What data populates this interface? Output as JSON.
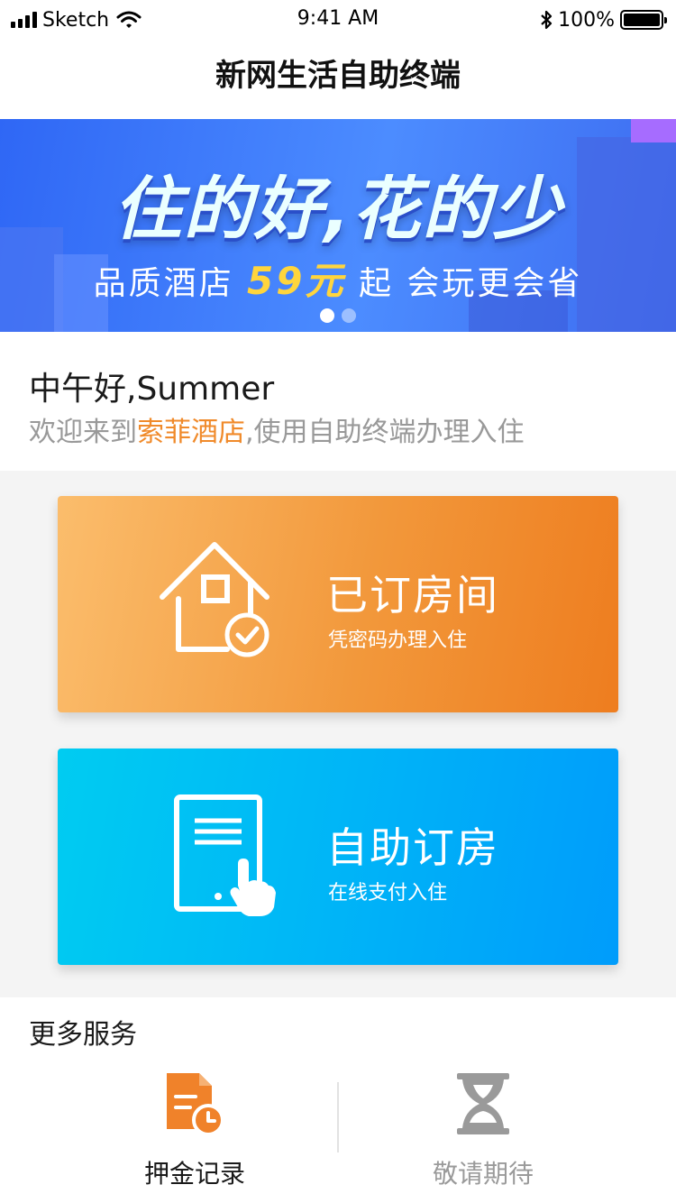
{
  "status_bar": {
    "carrier": "Sketch",
    "time": "9:41 AM",
    "battery_percent": "100%",
    "icons": [
      "signal-icon",
      "wifi-icon",
      "bluetooth-icon",
      "battery-icon"
    ]
  },
  "nav": {
    "title": "新网生活自助终端"
  },
  "banner": {
    "headline": "住的好,花的少",
    "subline_before": "品质酒店",
    "price": "59元",
    "subline_after": "起 会玩更会省",
    "slide_count": 2,
    "active_slide": 1,
    "colors": {
      "background": "#3f7bf7",
      "price": "#ffd53d"
    }
  },
  "greeting": {
    "text": "中午好,Summer",
    "welcome_before": "欢迎来到",
    "hotel_name": "索菲酒店",
    "welcome_after": ",使用自助终端办理入住",
    "colors": {
      "hotel_name": "#f08a2a"
    }
  },
  "cards": {
    "booked": {
      "title": "已订房间",
      "subtitle": "凭密码办理入住",
      "icon": "house-check-icon",
      "color": "#f2983b"
    },
    "self_booking": {
      "title": "自助订房",
      "subtitle": "在线支付入住",
      "icon": "tablet-tap-icon",
      "color": "#00b5f7"
    }
  },
  "more_services": {
    "title": "更多服务",
    "items": [
      {
        "label": "押金记录",
        "icon": "deposit-record-icon",
        "color": "#f0822a"
      },
      {
        "label": "敬请期待",
        "icon": "hourglass-icon",
        "color": "#9a9a9a"
      }
    ]
  }
}
